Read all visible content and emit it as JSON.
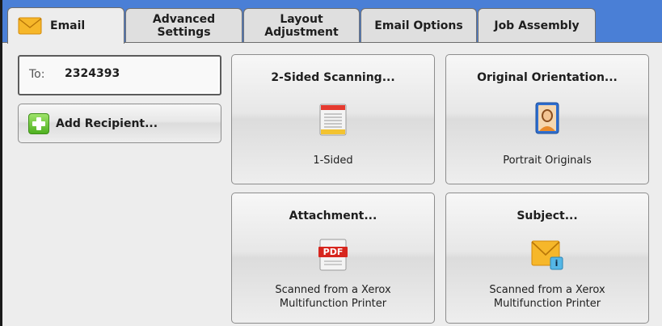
{
  "tabs": [
    {
      "label": "Email",
      "active": true,
      "icon": "envelope-icon"
    },
    {
      "label": "Advanced\nSettings",
      "active": false
    },
    {
      "label": "Layout\nAdjustment",
      "active": false
    },
    {
      "label": "Email Options",
      "active": false
    },
    {
      "label": "Job Assembly",
      "active": false
    }
  ],
  "recipient_field": {
    "label": "To:",
    "value": "2324393"
  },
  "add_recipient": {
    "label": "Add Recipient...",
    "icon": "plus-icon"
  },
  "features": {
    "two_sided": {
      "title": "2-Sided Scanning...",
      "value": "1-Sided",
      "icon": "one-sided-page-icon"
    },
    "orientation": {
      "title": "Original Orientation...",
      "value": "Portrait Originals",
      "icon": "portrait-icon"
    },
    "attachment": {
      "title": "Attachment...",
      "value_line1": "Scanned from a Xerox",
      "value_line2": "Multifunction Printer",
      "icon": "pdf-icon",
      "icon_text": "PDF"
    },
    "subject": {
      "title": "Subject...",
      "value_line1": "Scanned from a Xerox",
      "value_line2": "Multifunction Printer",
      "icon": "envelope-info-icon",
      "icon_text": "i"
    }
  },
  "colors": {
    "tabbar": "#4a7fd6",
    "panel": "#ededed",
    "tab": "#dfdfdf"
  }
}
